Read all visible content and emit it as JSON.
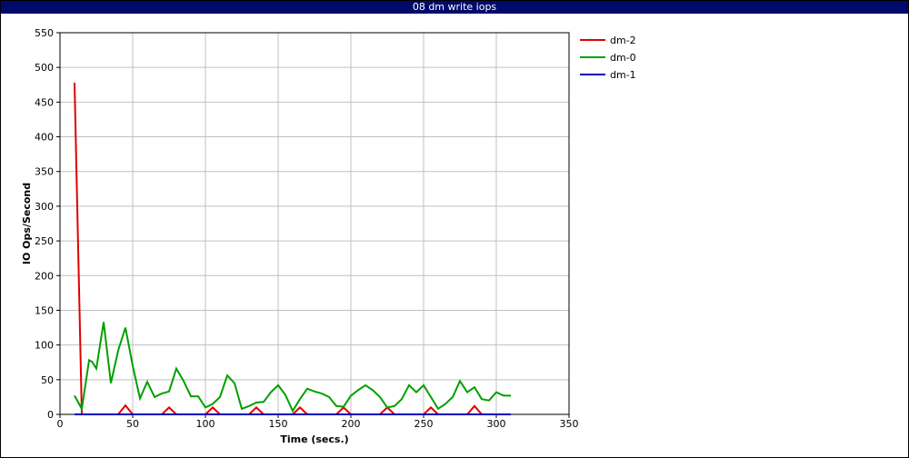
{
  "window": {
    "title": "08 dm write iops"
  },
  "chart_data": {
    "type": "line",
    "title": "08 dm write iops",
    "xlabel": "Time (secs.)",
    "ylabel": "IO Ops/Second",
    "xlim": [
      0,
      350
    ],
    "ylim": [
      0,
      550
    ],
    "xticks": [
      0,
      50,
      100,
      150,
      200,
      250,
      300,
      350
    ],
    "yticks": [
      0,
      50,
      100,
      150,
      200,
      250,
      300,
      350,
      400,
      450,
      500,
      550
    ],
    "grid": true,
    "legend_position": "right",
    "series": [
      {
        "name": "dm-2",
        "color": "#e00000",
        "x": [
          10,
          15,
          20,
          25,
          30,
          35,
          40,
          45,
          50,
          55,
          60,
          65,
          70,
          75,
          80,
          85,
          90,
          95,
          100,
          105,
          110,
          115,
          120,
          125,
          130,
          135,
          140,
          145,
          150,
          155,
          160,
          165,
          170,
          175,
          180,
          185,
          190,
          195,
          200,
          205,
          210,
          215,
          220,
          225,
          230,
          235,
          240,
          245,
          250,
          255,
          260,
          265,
          270,
          275,
          280,
          285,
          290,
          295,
          300,
          305,
          310
        ],
        "values": [
          478,
          0,
          0,
          0,
          0,
          0,
          0,
          13,
          0,
          0,
          0,
          0,
          0,
          10,
          0,
          0,
          0,
          0,
          0,
          10,
          0,
          0,
          0,
          0,
          0,
          10,
          0,
          0,
          0,
          0,
          0,
          10,
          0,
          0,
          0,
          0,
          0,
          10,
          0,
          0,
          0,
          0,
          0,
          10,
          0,
          0,
          0,
          0,
          0,
          10,
          0,
          0,
          0,
          0,
          0,
          12,
          0,
          0,
          0,
          0,
          0
        ]
      },
      {
        "name": "dm-0",
        "color": "#00a000",
        "x": [
          10,
          15,
          20,
          22,
          25,
          30,
          35,
          40,
          45,
          50,
          55,
          60,
          65,
          70,
          75,
          80,
          85,
          90,
          95,
          100,
          105,
          110,
          115,
          120,
          125,
          130,
          135,
          140,
          145,
          150,
          155,
          160,
          165,
          170,
          175,
          180,
          185,
          190,
          195,
          200,
          205,
          210,
          215,
          220,
          225,
          230,
          235,
          240,
          245,
          250,
          255,
          260,
          265,
          270,
          275,
          280,
          285,
          290,
          295,
          300,
          305,
          310
        ],
        "values": [
          27,
          8,
          78,
          76,
          66,
          133,
          45,
          92,
          125,
          70,
          23,
          47,
          25,
          30,
          33,
          66,
          48,
          26,
          26,
          10,
          15,
          25,
          56,
          45,
          8,
          12,
          17,
          18,
          32,
          42,
          28,
          5,
          22,
          37,
          33,
          30,
          25,
          12,
          11,
          27,
          35,
          42,
          35,
          25,
          10,
          12,
          22,
          42,
          32,
          42,
          25,
          8,
          15,
          25,
          48,
          32,
          39,
          22,
          20,
          32,
          27,
          27
        ]
      },
      {
        "name": "dm-1",
        "color": "#0000c0",
        "x": [
          10,
          310
        ],
        "values": [
          0,
          0
        ]
      }
    ]
  }
}
